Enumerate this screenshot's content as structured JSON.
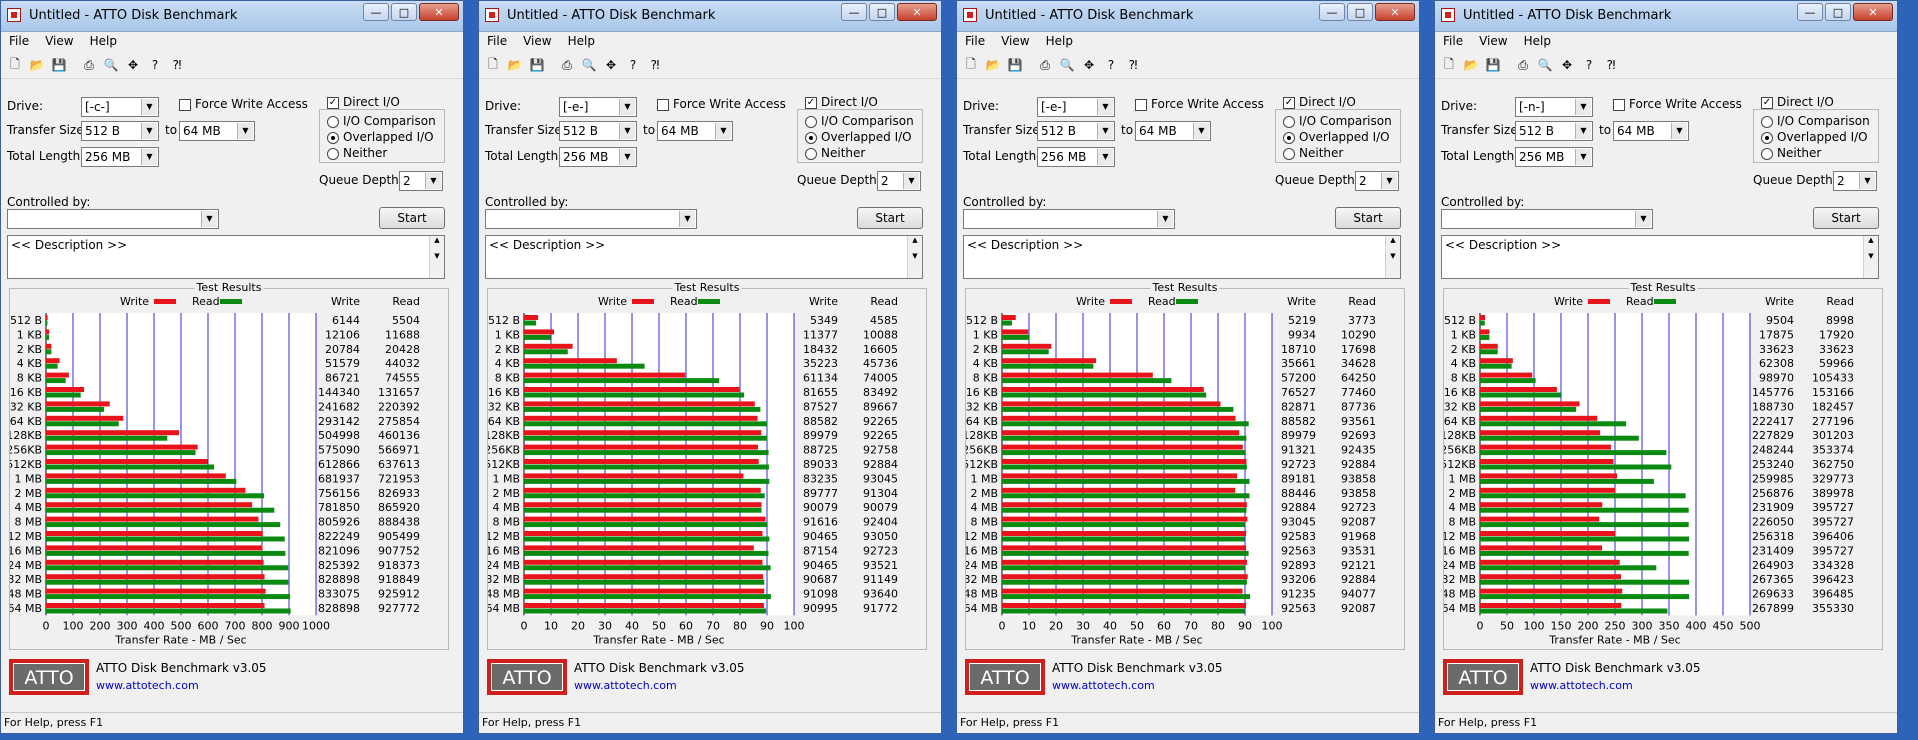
{
  "title": "Untitled - ATTO Disk Benchmark",
  "window_buttons": {
    "minimize": "—",
    "maximize": "□",
    "close": "✕"
  },
  "menu": [
    "File",
    "View",
    "Help"
  ],
  "labels": {
    "drive": "Drive:",
    "force_write": "Force Write Access",
    "direct_io": "Direct I/O",
    "transfer_size": "Transfer Size:",
    "to": "to",
    "total_length": "Total Length:",
    "io_comparison": "I/O Comparison",
    "overlapped_io": "Overlapped I/O",
    "neither": "Neither",
    "queue_depth": "Queue Depth:",
    "controlled_by": "Controlled by:",
    "start": "Start",
    "description": "<< Description >>",
    "test_results": "Test Results",
    "legend_write": "Write",
    "legend_read": "Read",
    "col_write": "Write",
    "col_read": "Read",
    "x_axis_title": "Transfer Rate - MB / Sec",
    "version": "ATTO Disk Benchmark v3.05",
    "url": "www.attotech.com",
    "logo": "ATTO",
    "status": "For Help, press F1"
  },
  "settings": {
    "transfer_from": "512 B",
    "transfer_to": "64 MB",
    "total_length": "256 MB",
    "queue_depth": "2",
    "force_write_checked": false,
    "direct_io_checked": true,
    "selected_mode": "overlapped"
  },
  "colors": {
    "write": "#e8141b",
    "read": "#0b8a12",
    "grid": "#2b2bd8",
    "accent": "#d0201c"
  },
  "sizes": [
    "512 B",
    "1 KB",
    "2 KB",
    "4 KB",
    "8 KB",
    "16 KB",
    "32 KB",
    "64 KB",
    "128KB",
    "256KB",
    "512KB",
    "1 MB",
    "2 MB",
    "4 MB",
    "8 MB",
    "12 MB",
    "16 MB",
    "24 MB",
    "32 MB",
    "48 MB",
    "64 MB"
  ],
  "windows": [
    {
      "drive": "[-c-]",
      "chart_data": {
        "type": "bar",
        "orientation": "horizontal",
        "unit": "KB/s",
        "x_ticks": [
          "0",
          "100",
          "200",
          "300",
          "400",
          "500",
          "600",
          "700",
          "800",
          "900",
          "1000"
        ],
        "xlim": [
          0,
          1000
        ],
        "write": [
          6144,
          12106,
          20784,
          51579,
          86721,
          144340,
          241682,
          293142,
          504998,
          575090,
          612866,
          681937,
          756156,
          781850,
          805926,
          822249,
          821096,
          825392,
          828898,
          833075,
          828898
        ],
        "read": [
          5504,
          11688,
          20428,
          44032,
          74555,
          131657,
          220392,
          275854,
          460136,
          566971,
          637613,
          721953,
          826933,
          865920,
          888438,
          905499,
          907752,
          918373,
          918849,
          925912,
          927772
        ]
      }
    },
    {
      "drive": "[-e-]",
      "chart_data": {
        "type": "bar",
        "orientation": "horizontal",
        "unit": "KB/s",
        "x_ticks": [
          "0",
          "10",
          "20",
          "30",
          "40",
          "50",
          "60",
          "70",
          "80",
          "90",
          "100"
        ],
        "xlim": [
          0,
          100
        ],
        "write": [
          5349,
          11377,
          18432,
          35223,
          61134,
          81655,
          87527,
          88582,
          89979,
          88725,
          89033,
          83235,
          89777,
          90079,
          91616,
          90465,
          87154,
          90465,
          90687,
          91098,
          90995
        ],
        "read": [
          4585,
          10088,
          16605,
          45736,
          74005,
          83492,
          89667,
          92265,
          92265,
          92758,
          92884,
          93045,
          91304,
          90079,
          92404,
          93050,
          92723,
          93521,
          91149,
          93640,
          91772
        ]
      }
    },
    {
      "drive": "[-e-]",
      "chart_data": {
        "type": "bar",
        "orientation": "horizontal",
        "unit": "KB/s",
        "x_ticks": [
          "0",
          "10",
          "20",
          "30",
          "40",
          "50",
          "60",
          "70",
          "80",
          "90",
          "100"
        ],
        "xlim": [
          0,
          100
        ],
        "write": [
          5219,
          9934,
          18710,
          35661,
          57200,
          76527,
          82871,
          88582,
          89979,
          91321,
          92723,
          89181,
          88446,
          92884,
          93045,
          92583,
          92563,
          92893,
          93206,
          91235,
          92563
        ],
        "read": [
          3773,
          10290,
          17698,
          34628,
          64250,
          77460,
          87736,
          93561,
          92693,
          92435,
          92884,
          93858,
          93858,
          92723,
          92087,
          91968,
          93531,
          92121,
          92884,
          94077,
          92087
        ]
      }
    },
    {
      "drive": "[-n-]",
      "chart_data": {
        "type": "bar",
        "orientation": "horizontal",
        "unit": "KB/s",
        "x_ticks": [
          "0",
          "50",
          "100",
          "150",
          "200",
          "250",
          "300",
          "350",
          "400",
          "450",
          "500"
        ],
        "xlim": [
          0,
          500
        ],
        "write": [
          9504,
          17875,
          33623,
          62308,
          98970,
          145776,
          188730,
          222417,
          227829,
          248244,
          253240,
          259985,
          256876,
          231909,
          226050,
          256318,
          231409,
          264903,
          267365,
          269633,
          267899
        ],
        "read": [
          8998,
          17920,
          33623,
          59966,
          105433,
          153166,
          182457,
          277196,
          301203,
          353374,
          362750,
          329773,
          389978,
          395727,
          395727,
          396406,
          395727,
          334328,
          396423,
          396485,
          355330
        ]
      }
    }
  ]
}
